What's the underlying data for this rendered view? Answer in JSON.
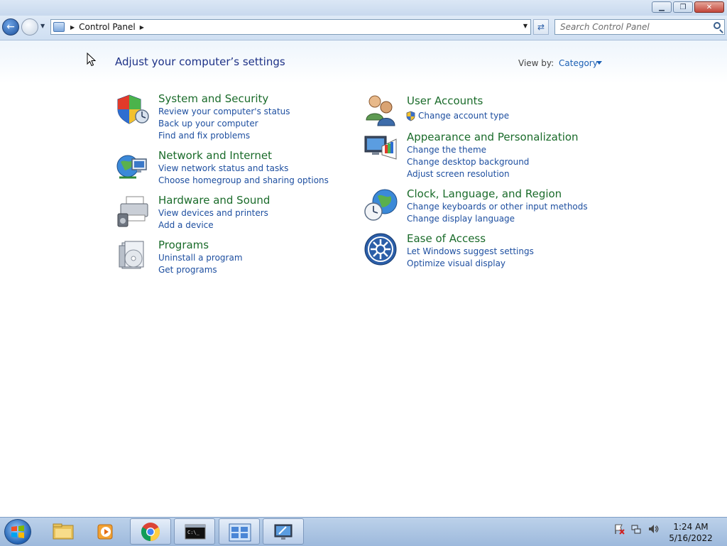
{
  "window": {
    "minimize": "▁",
    "restore": "❐",
    "close": "✕"
  },
  "address": {
    "path": "Control Panel",
    "search_placeholder": "Search Control Panel"
  },
  "page": {
    "heading": "Adjust your computer’s settings",
    "view_by_label": "View by:",
    "view_by_value": "Category"
  },
  "categories": [
    {
      "title": "System and Security",
      "icon": "shield-icon",
      "links": [
        "Review your computer's status",
        "Back up your computer",
        "Find and fix problems"
      ]
    },
    {
      "title": "Network and Internet",
      "icon": "network-globe-icon",
      "links": [
        "View network status and tasks",
        "Choose homegroup and sharing options"
      ]
    },
    {
      "title": "Hardware and Sound",
      "icon": "printer-speaker-icon",
      "links": [
        "View devices and printers",
        "Add a device"
      ]
    },
    {
      "title": "Programs",
      "icon": "programs-disc-icon",
      "links": [
        "Uninstall a program",
        "Get programs"
      ]
    },
    {
      "title": "User Accounts",
      "icon": "users-icon",
      "links": [
        "Change account type"
      ]
    },
    {
      "title": "Appearance and Personalization",
      "icon": "monitor-palette-icon",
      "links": [
        "Change the theme",
        "Change desktop background",
        "Adjust screen resolution"
      ]
    },
    {
      "title": "Clock, Language, and Region",
      "icon": "globe-clock-icon",
      "links": [
        "Change keyboards or other input methods",
        "Change display language"
      ]
    },
    {
      "title": "Ease of Access",
      "icon": "ease-of-access-icon",
      "links": [
        "Let Windows suggest settings",
        "Optimize visual display"
      ]
    }
  ],
  "taskbar": {
    "time": "1:24 AM",
    "date": "5/16/2022"
  },
  "colors": {
    "link": "#1e4fa0",
    "category_title": "#1a6b2a",
    "heading": "#1e3287"
  }
}
